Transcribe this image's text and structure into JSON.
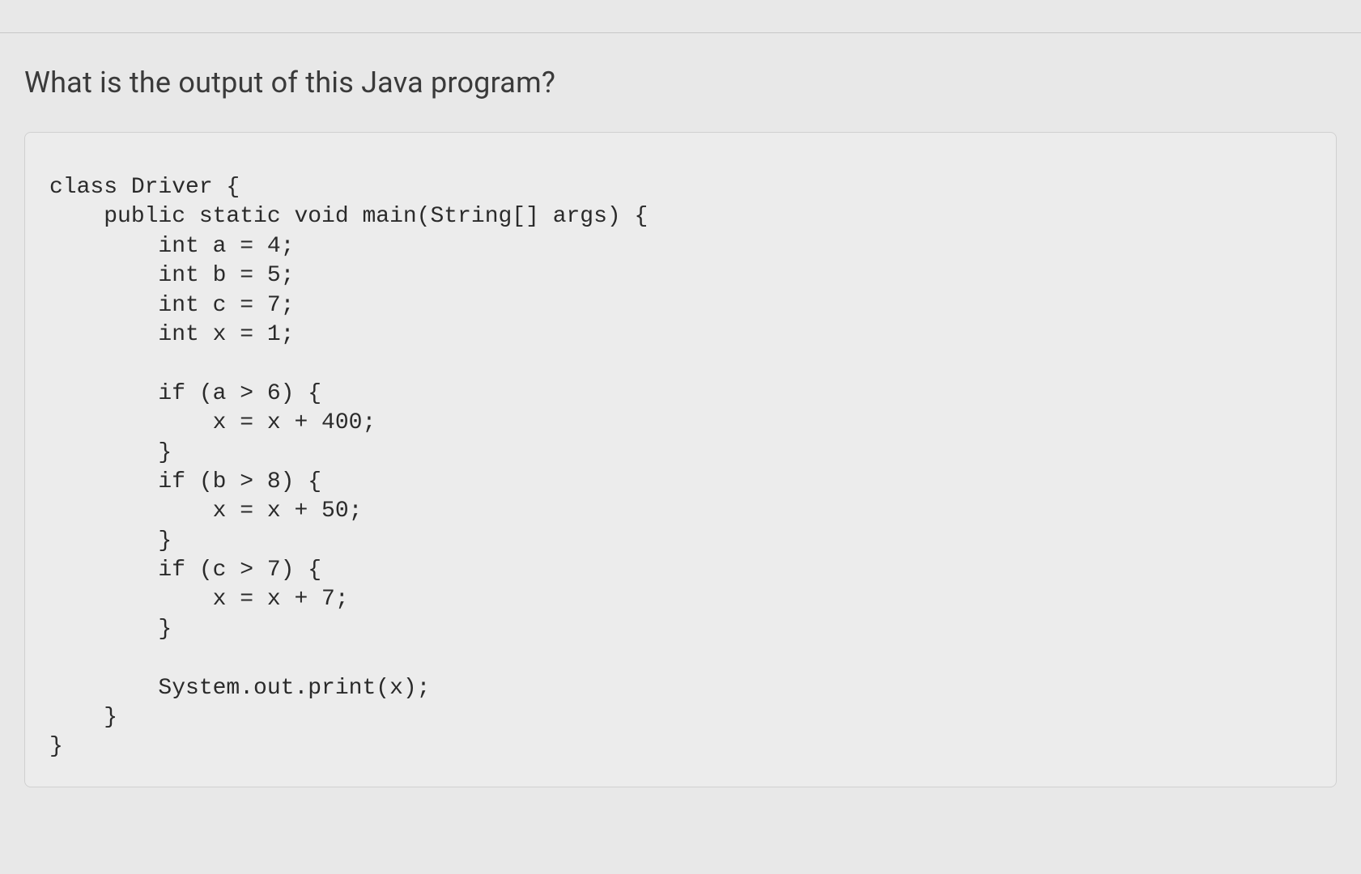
{
  "question": "What is the output of this Java program?",
  "code": "class Driver {\n    public static void main(String[] args) {\n        int a = 4;\n        int b = 5;\n        int c = 7;\n        int x = 1;\n\n        if (a > 6) {\n            x = x + 400;\n        }\n        if (b > 8) {\n            x = x + 50;\n        }\n        if (c > 7) {\n            x = x + 7;\n        }\n\n        System.out.print(x);\n    }\n}"
}
